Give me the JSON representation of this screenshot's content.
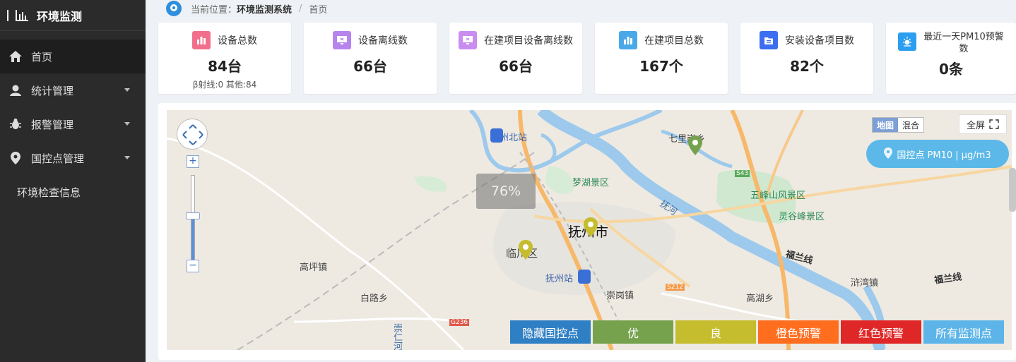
{
  "app": {
    "title": "环境监测"
  },
  "sidebar": {
    "items": [
      {
        "label": "首页",
        "icon": "home-icon",
        "active": true
      },
      {
        "label": "统计管理",
        "icon": "user-icon"
      },
      {
        "label": "报警管理",
        "icon": "bug-icon"
      },
      {
        "label": "国控点管理",
        "icon": "location-icon"
      }
    ],
    "sub_item": "环境检查信息"
  },
  "breadcrumb": {
    "prefix": "当前位置：",
    "system": "环境监测系统",
    "separator": "/",
    "current": "首页"
  },
  "stats": [
    {
      "label": "设备总数",
      "value": "84台",
      "sub": "β射线:0  其他:84",
      "color": "#f16f8b"
    },
    {
      "label": "设备离线数",
      "value": "66台",
      "sub": "",
      "color": "#b784ee"
    },
    {
      "label": "在建项目设备离线数",
      "value": "66台",
      "sub": "",
      "color": "#c98df0"
    },
    {
      "label": "在建项目总数",
      "value": "167个",
      "sub": "",
      "color": "#4aa8e8"
    },
    {
      "label": "安装设备项目数",
      "value": "82个",
      "sub": "",
      "color": "#3b6ef0"
    },
    {
      "label_line1": "最近一天PM10预警",
      "label_line2": "数",
      "value": "0条",
      "sub": "",
      "color": "#2b9ef0"
    }
  ],
  "map": {
    "zoom_percent": "76%",
    "map_type": {
      "map": "地图",
      "hybrid": "混合"
    },
    "fullscreen_label": "全屏",
    "layer_button": "国控点 PM10 | μg/m3",
    "labels": {
      "fuzhou_north": "抚州北站",
      "qili": "七里岗乡",
      "menghu": "梦湖景区",
      "fuhe": "抚河",
      "wufeng": "五峰山风景区",
      "linggu": "灵谷峰景区",
      "fuzhou_city": "抚州市",
      "linchuan": "临川区",
      "gaoping": "高坪镇",
      "fulan1": "福兰线",
      "fulan2": "福兰线",
      "fuzhou_station": "抚州站",
      "chonggang": "崇岗镇",
      "xuwan": "浒湾镇",
      "bailu": "白路乡",
      "gaohu": "高湖乡",
      "chongren": "崇仁河",
      "s43": "S43",
      "s212": "S212",
      "g236": "G236"
    }
  },
  "legend": [
    {
      "label": "隐藏国控点",
      "color": "#2f7fc4"
    },
    {
      "label": "优",
      "color": "#76a24e"
    },
    {
      "label": "良",
      "color": "#c6bd2e"
    },
    {
      "label": "橙色预警",
      "color": "#ff6d1f"
    },
    {
      "label": "红色预警",
      "color": "#e02727"
    },
    {
      "label": "所有监测点",
      "color": "#5cb4e8"
    }
  ]
}
